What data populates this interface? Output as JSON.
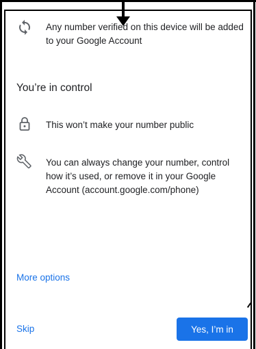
{
  "items": [
    {
      "icon": "sync-icon",
      "text": "Any number verified on this device will be added to your Google Account"
    },
    {
      "icon": "lock-icon",
      "text": "This won’t make your number public"
    },
    {
      "icon": "wrench-icon",
      "text": "You can always change your number, control how it’s used, or remove it in your Google Account (account.google.com/phone)"
    }
  ],
  "section_title": "You’re in control",
  "more_options_label": "More options",
  "skip_label": "Skip",
  "confirm_label": "Yes, I’m in",
  "colors": {
    "accent": "#1a73e8",
    "text": "#202124",
    "icon": "#5f6368"
  }
}
